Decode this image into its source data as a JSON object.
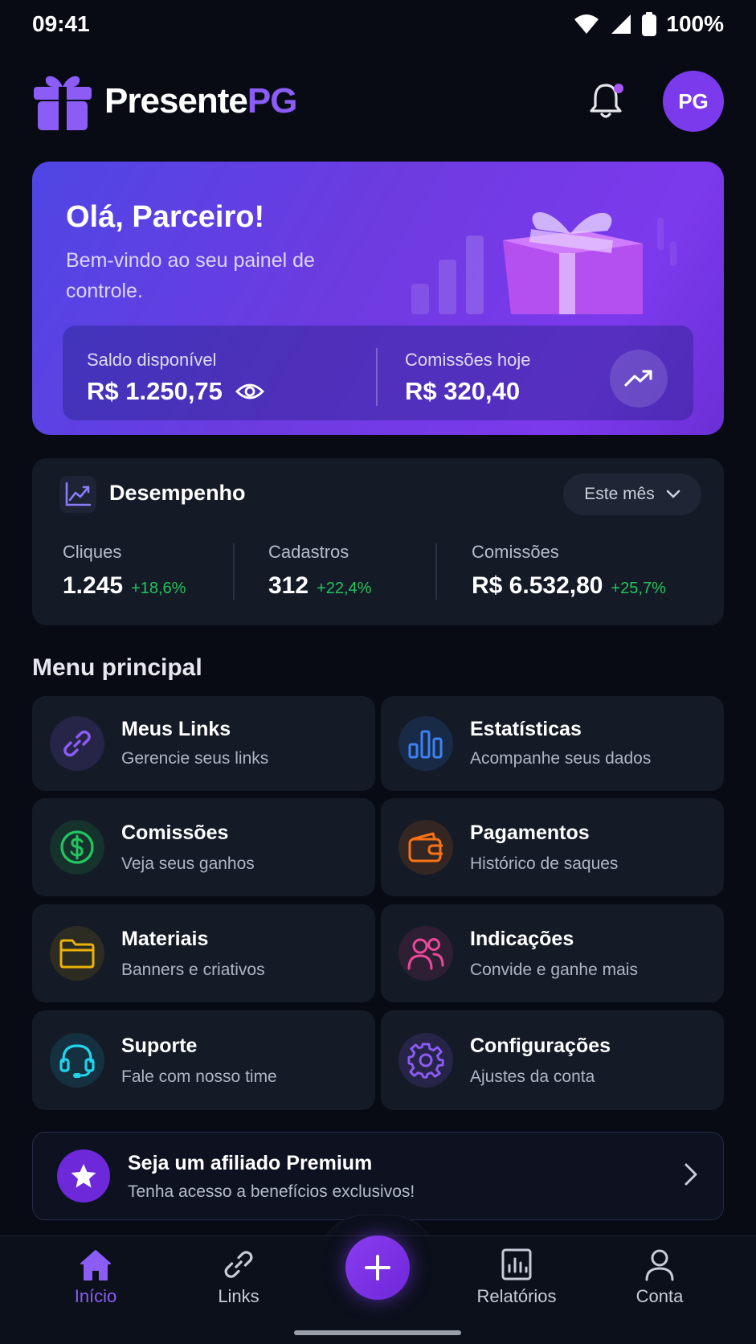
{
  "status_bar": {
    "time": "09:41",
    "battery": "100%"
  },
  "header": {
    "logo_main": "Presente",
    "logo_accent": "PG",
    "avatar_initials": "PG"
  },
  "hero": {
    "greeting": "Olá, Parceiro!",
    "subtitle": "Bem-vindo ao seu painel de controle.",
    "balance_label": "Saldo disponível",
    "balance_value": "R$ 1.250,75",
    "commission_label": "Comissões hoje",
    "commission_value": "R$ 320,40"
  },
  "performance": {
    "title": "Desempenho",
    "period": "Este mês",
    "stats": [
      {
        "label": "Cliques",
        "value": "1.245",
        "delta": "+18,6%"
      },
      {
        "label": "Cadastros",
        "value": "312",
        "delta": "+22,4%"
      },
      {
        "label": "Comissões",
        "value": "R$ 6.532,80",
        "delta": "+25,7%"
      }
    ]
  },
  "menu": {
    "title": "Menu principal",
    "items": [
      {
        "label": "Meus Links",
        "desc": "Gerencie seus links",
        "icon": "link-icon",
        "color": "#8b5cf6"
      },
      {
        "label": "Estatísticas",
        "desc": "Acompanhe seus dados",
        "icon": "bar-chart-icon",
        "color": "#3b82f6"
      },
      {
        "label": "Comissões",
        "desc": "Veja seus ganhos",
        "icon": "dollar-icon",
        "color": "#22c55e"
      },
      {
        "label": "Pagamentos",
        "desc": "Histórico de saques",
        "icon": "wallet-icon",
        "color": "#f97316"
      },
      {
        "label": "Materiais",
        "desc": "Banners e criativos",
        "icon": "folder-icon",
        "color": "#eab308"
      },
      {
        "label": "Indicações",
        "desc": "Convide e ganhe mais",
        "icon": "users-icon",
        "color": "#ec4899"
      },
      {
        "label": "Suporte",
        "desc": "Fale com nosso time",
        "icon": "headset-icon",
        "color": "#22d3ee"
      },
      {
        "label": "Configurações",
        "desc": "Ajustes da conta",
        "icon": "gear-icon",
        "color": "#8b5cf6"
      }
    ]
  },
  "premium": {
    "title": "Seja um afiliado Premium",
    "subtitle": "Tenha acesso a benefícios exclusivos!"
  },
  "bottom_nav": {
    "items": [
      {
        "label": "Início",
        "icon": "home-icon"
      },
      {
        "label": "Links",
        "icon": "link-icon"
      },
      {
        "label": "Relatórios",
        "icon": "report-icon"
      },
      {
        "label": "Conta",
        "icon": "user-icon"
      }
    ],
    "active": "Início",
    "fab_icon": "plus-icon"
  },
  "colors": {
    "accent": "#7c3aed",
    "positive": "#22c55e",
    "background": "#080b14",
    "card": "#141a26"
  }
}
